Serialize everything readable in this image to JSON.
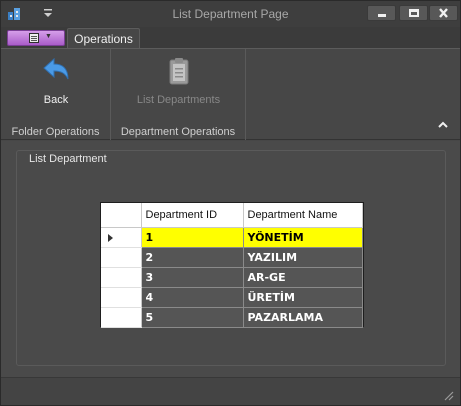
{
  "window": {
    "title": "List Department Page"
  },
  "quick_access": {
    "dropdown_icon": "chevron-down-icon"
  },
  "ribbon": {
    "tabs": [
      {
        "label": "Operations",
        "active": true
      }
    ],
    "groups": [
      {
        "label": "Folder Operations",
        "buttons": [
          {
            "label": "Back",
            "icon": "back-arrow-icon",
            "enabled": true
          }
        ]
      },
      {
        "label": "Department Operations",
        "buttons": [
          {
            "label": "List Departments",
            "icon": "clipboard-icon",
            "enabled": false
          }
        ]
      }
    ]
  },
  "main": {
    "groupbox_title": "List Department",
    "grid": {
      "columns": [
        "Department ID",
        "Department Name"
      ],
      "rows": [
        {
          "id": "1",
          "name": "YÖNETİM",
          "selected": true
        },
        {
          "id": "2",
          "name": "YAZILIM",
          "selected": false
        },
        {
          "id": "3",
          "name": "AR-GE",
          "selected": false
        },
        {
          "id": "4",
          "name": "ÜRETİM",
          "selected": false
        },
        {
          "id": "5",
          "name": "PAZARLAMA",
          "selected": false
        }
      ]
    }
  },
  "colors": {
    "selected_row": "#ffff00",
    "app_menu": "#b86fd6",
    "back_icon": "#3d8fe0"
  }
}
